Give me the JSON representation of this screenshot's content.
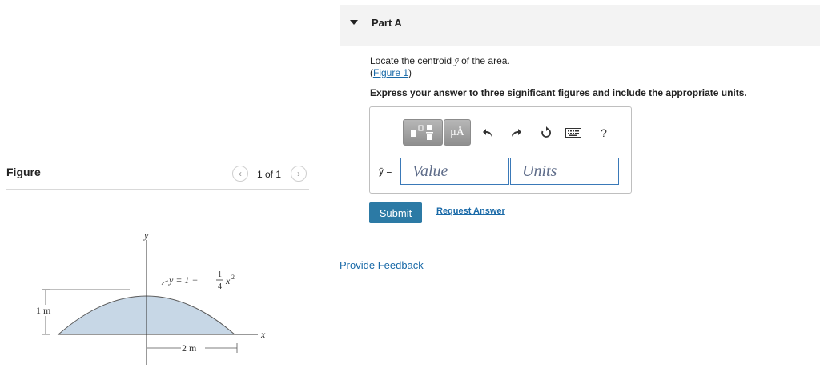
{
  "figure_panel": {
    "title": "Figure",
    "pager_text": "1 of 1",
    "prev_icon": "chevron-left-icon",
    "next_icon": "chevron-right-icon",
    "diagram": {
      "y_axis_label": "y",
      "x_axis_label": "x",
      "curve_eq_lhs": "y = 1 −",
      "curve_eq_num": "1",
      "curve_eq_den": "4",
      "curve_eq_var": "x",
      "curve_eq_pow": "2",
      "height_label": "1 m",
      "width_label": "2 m",
      "fill_color": "#c7d7e6"
    }
  },
  "part": {
    "title": "Part A",
    "question_prefix": "Locate the centroid ",
    "question_var": "ȳ",
    "question_suffix": " of the area.",
    "figure_link_open": "(",
    "figure_link": "Figure 1",
    "figure_link_close": ")",
    "instruction": "Express your answer to three significant figures and include the appropriate units.",
    "toolbar": {
      "template_icon": "template-icon",
      "units_label": "μÅ",
      "undo_icon": "undo-icon",
      "redo_icon": "redo-icon",
      "reset_icon": "reset-icon",
      "keyboard_icon": "keyboard-icon",
      "help_label": "?"
    },
    "answer_label": "ȳ =",
    "value_placeholder": "Value",
    "units_placeholder": "Units",
    "submit_label": "Submit",
    "request_answer_label": "Request Answer",
    "feedback_label": "Provide Feedback",
    "colors": {
      "link": "#1a6aa8",
      "submit_bg": "#2c7aa5",
      "input_border": "#3a79b8"
    }
  }
}
